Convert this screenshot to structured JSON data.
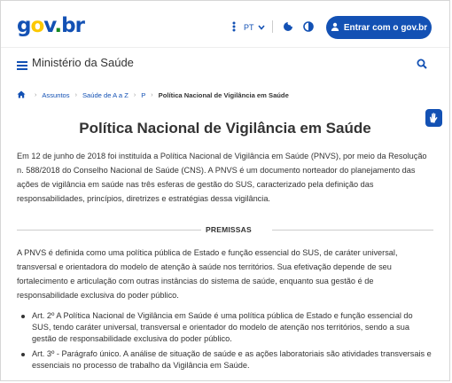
{
  "header": {
    "logo_parts": [
      "g",
      "o",
      "v",
      ".",
      "br"
    ],
    "language": "PT",
    "login_label": "Entrar com o gov.br"
  },
  "ministry": {
    "title": "Ministério da Saúde"
  },
  "breadcrumb": {
    "items": [
      "Assuntos",
      "Saúde de A a Z",
      "P"
    ],
    "current": "Política Nacional de Vigilância em Saúde"
  },
  "page": {
    "title": "Política Nacional de Vigilância em Saúde",
    "intro": "Em 12 de junho de 2018 foi instituída a Política Nacional de Vigilância em Saúde (PNVS), por meio da Resolução n. 588/2018 do Conselho Nacional de Saúde (CNS). A PNVS é um documento norteador do planejamento das ações de vigilância em saúde nas três esferas de gestão do SUS, caracterizado pela definição das responsabilidades, princípios, diretrizes e estratégias dessa vigilância.",
    "section_heading": "PREMISSAS",
    "premissas_text": "A PNVS é definida como uma política pública de Estado e função essencial do SUS, de caráter universal, transversal e orientadora do modelo de atenção à saúde nos territórios. Sua efetivação depende de seu fortalecimento e articulação com outras instâncias do sistema de saúde, enquanto sua gestão é de responsabilidade exclusiva do poder público.",
    "list_items": [
      "Art. 2º A Política Nacional de Vigilância em Saúde é uma política pública de Estado e função essencial do SUS, tendo caráter universal, transversal e orientador do modelo de atenção nos territórios, sendo a sua gestão de responsabilidade exclusiva do poder público.",
      "Art. 3º - Parágrafo único. A análise de situação de saúde e as ações laboratoriais são atividades transversais e essenciais no processo de trabalho da Vigilância em Saúde."
    ]
  },
  "colors": {
    "brand_blue": "#1351b4",
    "logo_yellow": "#fcc800",
    "logo_green": "#168821",
    "text": "#333333"
  },
  "icons": [
    "kebab-menu-icon",
    "chevron-down-icon",
    "cookie-icon",
    "contrast-icon",
    "user-icon",
    "hamburger-menu-icon",
    "search-icon",
    "home-icon",
    "chevron-right-icon",
    "accessibility-hands-icon"
  ]
}
